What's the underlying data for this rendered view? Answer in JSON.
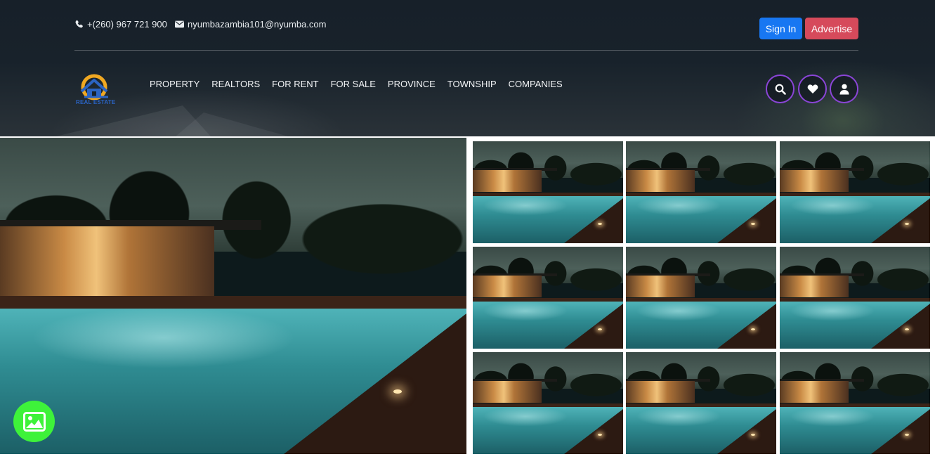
{
  "contact": {
    "phone": "+(260) 967 721 900",
    "email": "nyumbazambia101@nyumba.com",
    "phone_icon": "phone-icon",
    "email_icon": "envelope-icon"
  },
  "auth": {
    "sign_in_label": "Sign In",
    "advertise_label": "Advertise"
  },
  "logo": {
    "text": "REAL ESTATE"
  },
  "nav": {
    "items": [
      {
        "label": "PROPERTY"
      },
      {
        "label": "REALTORS"
      },
      {
        "label": "FOR RENT"
      },
      {
        "label": "FOR SALE"
      },
      {
        "label": "PROVINCE"
      },
      {
        "label": "TOWNSHIP"
      },
      {
        "label": "COMPANIES"
      }
    ]
  },
  "header_icons": [
    "search-icon",
    "heart-icon",
    "user-icon"
  ],
  "gallery": {
    "main_image": "pool-house-night-photo",
    "thumbnail_count": 9,
    "fab_icon": "image-icon"
  },
  "colors": {
    "sign_in": "#1877f2",
    "advertise": "#d64a5b",
    "icon_border": "#8b45d8",
    "fab": "#3ef23a"
  }
}
